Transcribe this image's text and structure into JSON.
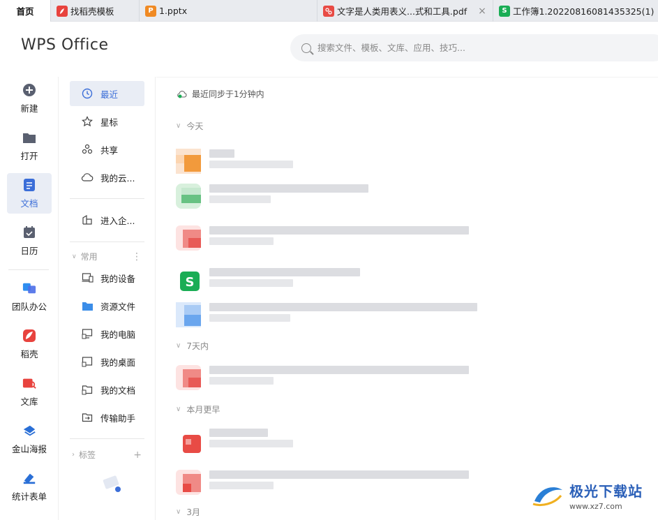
{
  "tabs": [
    {
      "label": "首页"
    },
    {
      "label": "找稻壳模板"
    },
    {
      "label": "1.pptx"
    },
    {
      "label": "文字是人类用表义...式和工具.pdf"
    },
    {
      "label": "工作簿1.20220816081435325(1)"
    }
  ],
  "tab_close_glyph": "×",
  "header": {
    "logo_text": "WPS Office",
    "search_placeholder": "搜索文件、模板、文库、应用、技巧..."
  },
  "rail": {
    "items": [
      {
        "label": "新建",
        "icon": "plus-circle-icon"
      },
      {
        "label": "打开",
        "icon": "folder-icon"
      },
      {
        "label": "文档",
        "icon": "document-icon",
        "active": true
      },
      {
        "label": "日历",
        "icon": "calendar-icon"
      },
      {
        "label": "团队办公",
        "icon": "team-icon"
      },
      {
        "label": "稻壳",
        "icon": "docer-icon"
      },
      {
        "label": "文库",
        "icon": "library-icon"
      },
      {
        "label": "金山海报",
        "icon": "poster-icon"
      },
      {
        "label": "统计表单",
        "icon": "form-icon"
      }
    ]
  },
  "nav": {
    "items": [
      {
        "label": "最近",
        "icon": "clock-icon",
        "active": true
      },
      {
        "label": "星标",
        "icon": "star-icon"
      },
      {
        "label": "共享",
        "icon": "share-icon"
      },
      {
        "label": "我的云...",
        "icon": "cloud-icon"
      }
    ],
    "enterprise": "进入企...",
    "common_header": "常用",
    "common_items": [
      {
        "label": "我的设备",
        "icon": "device-icon"
      },
      {
        "label": "资源文件",
        "icon": "resource-folder-icon"
      },
      {
        "label": "我的电脑",
        "icon": "computer-icon"
      },
      {
        "label": "我的桌面",
        "icon": "desktop-icon"
      },
      {
        "label": "我的文档",
        "icon": "my-docs-icon"
      },
      {
        "label": "传输助手",
        "icon": "transfer-icon"
      }
    ],
    "tags_header": "标签"
  },
  "main": {
    "sync_status": "最近同步于1分钟内",
    "groups": [
      {
        "label": "今天"
      },
      {
        "label": "7天内"
      },
      {
        "label": "本月更早"
      },
      {
        "label": "3月"
      }
    ]
  },
  "watermark": {
    "title": "极光下载站",
    "url": "www.xz7.com"
  },
  "colors": {
    "accent": "#3b6ed8",
    "ppt": "#f08a24",
    "pdf": "#e84b45",
    "et": "#1aad55",
    "docer": "#e8433e"
  }
}
